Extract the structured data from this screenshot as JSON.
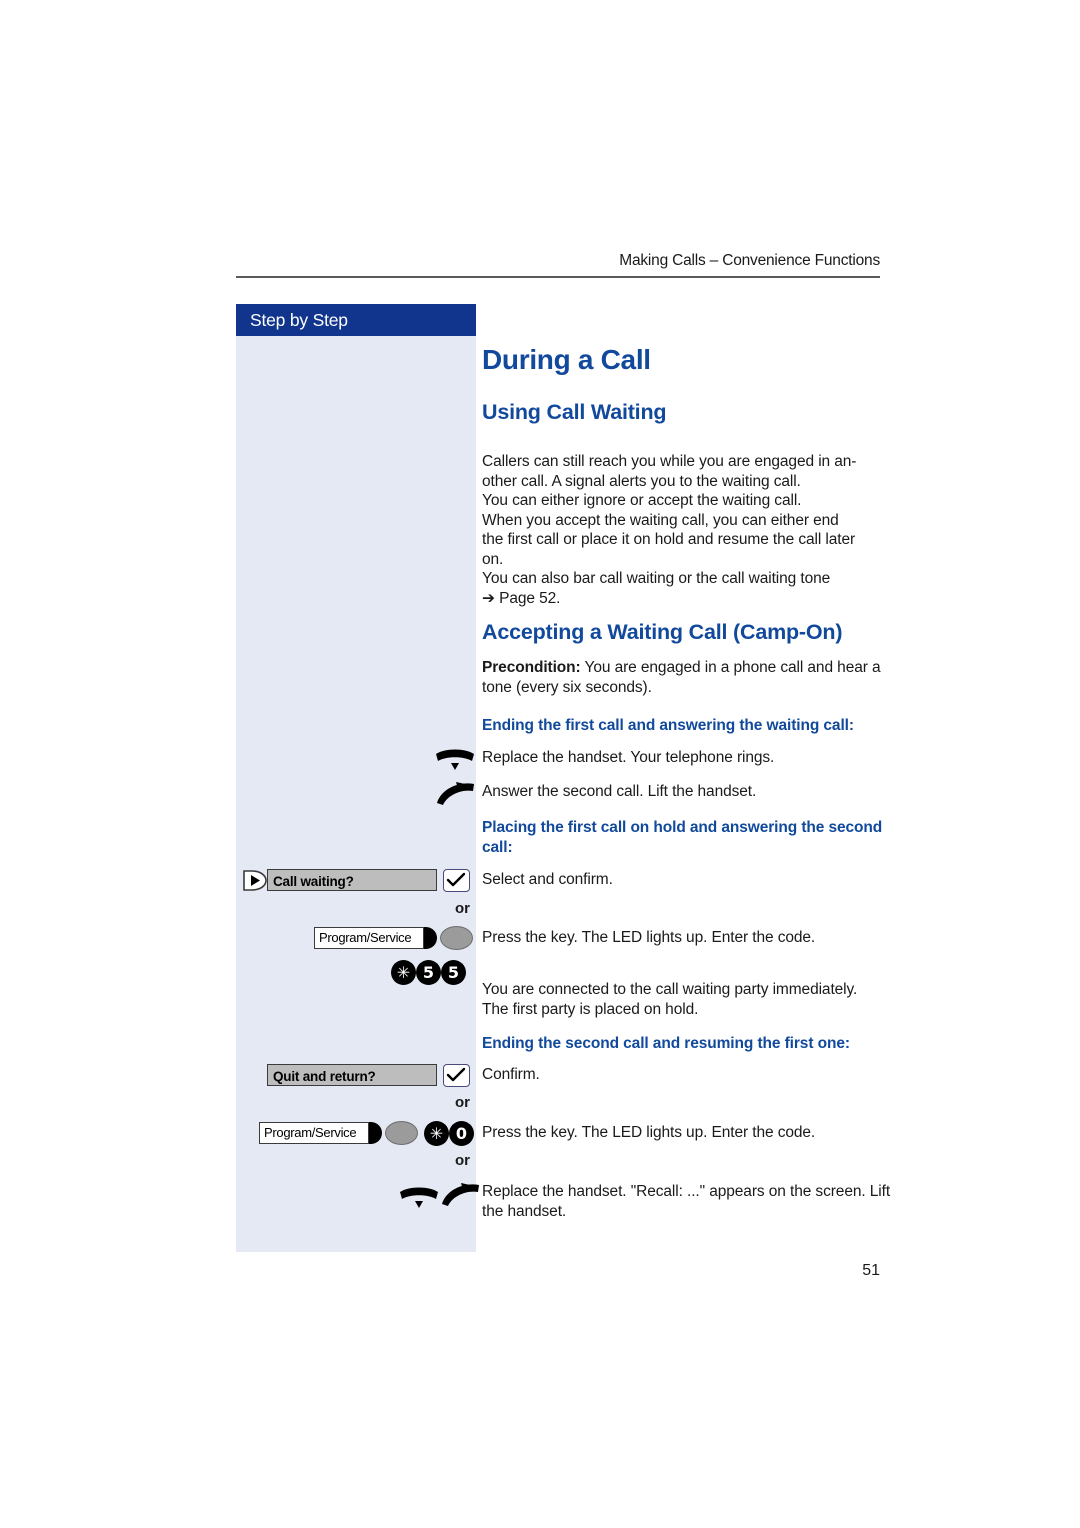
{
  "header": {
    "running_head": "Making Calls – Convenience Functions"
  },
  "sidebar": {
    "title": "Step by Step"
  },
  "page": {
    "title": "During a Call",
    "number": "51"
  },
  "sections": [
    {
      "heading": "Using Call Waiting",
      "paragraph": "Callers can still reach you while you are engaged in another call. A signal alerts you to the waiting call.\nYou can either ignore or accept the waiting call.\nWhen you accept the waiting call, you can either end the first call or place it on hold and resume the call later on.\nYou can also bar call waiting or the call waiting tone\n➔ Page 52."
    },
    {
      "heading": "Accepting a Waiting Call (Camp-On)"
    }
  ],
  "body": {
    "using_call_waiting_lines": [
      "Callers can still reach you while you are engaged in an-",
      "other call. A signal alerts you to the waiting call.",
      "You can either ignore or accept the waiting call.",
      "When you accept the waiting call, you can either end",
      "the first call or place it on hold and resume the call later",
      "on.",
      "You can also bar call waiting or the call waiting tone",
      "➔ Page 52."
    ],
    "precondition_label": "Precondition:",
    "precondition_text": " You are engaged in a phone call and hear a tone (every six seconds).",
    "heading_end_first": "Ending the first call and answering the waiting call:",
    "step_replace_handset": "Replace the handset. Your telephone rings.",
    "step_answer_second": "Answer the second call. Lift the handset.",
    "heading_place_on_hold": "Placing the first call on hold and answering the second call:",
    "step_select_confirm": "Select and confirm.",
    "step_press_key_code_1": "Press the key. The LED lights up. Enter the code.",
    "step_connected": "You are connected to the call waiting party immediately. The first party is placed on hold.",
    "heading_end_second": "Ending the second call and resuming the first one:",
    "step_confirm": "Confirm.",
    "step_press_key_code_2": "Press the key. The LED lights up. Enter the code.",
    "step_recall": "Replace the handset. \"Recall: ...\" appears on the screen. Lift the handset."
  },
  "widgets": {
    "or_label": "or",
    "menu_call_waiting": "Call waiting?",
    "menu_quit_return": "Quit and return?",
    "fnkey_program_service": "Program/Service",
    "code_camp_on": [
      "✳",
      "5",
      "5"
    ],
    "code_quit": [
      "✳",
      "0"
    ],
    "icons": {
      "nav_select": "navigation-select-key",
      "confirm": "confirm-checkmark-key",
      "replace_handset": "replace-handset-icon",
      "lift_handset": "lift-handset-icon",
      "led": "led-indicator"
    }
  },
  "colors": {
    "brand_blue": "#11499c",
    "sidebar_header": "#11348c",
    "sidebar_bg": "#e4e9f4",
    "menu_gray": "#bdbdbd"
  }
}
